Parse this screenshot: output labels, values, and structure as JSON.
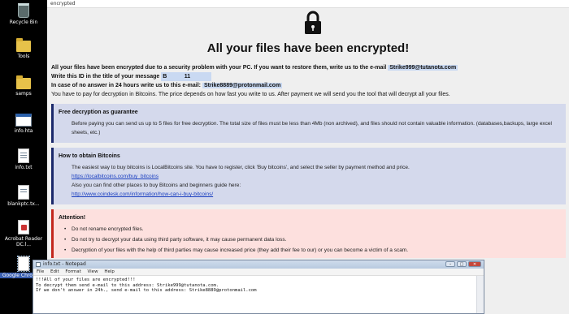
{
  "desktop": {
    "icons": [
      {
        "label": "Recycle Bin",
        "icon": "recycle-bin-icon"
      },
      {
        "label": "Tools",
        "icon": "folder-icon"
      },
      {
        "label": "samps",
        "icon": "folder-icon"
      },
      {
        "label": "info.hta",
        "icon": "hta-icon"
      },
      {
        "label": "info.txt",
        "icon": "text-file-icon"
      },
      {
        "label": "blankptc.tx...",
        "icon": "text-file-icon"
      },
      {
        "label": "Acrobat Reader DC.l...",
        "icon": "pdf-icon"
      },
      {
        "label": "Google Chrome...",
        "icon": "file-icon"
      }
    ]
  },
  "ransom_window": {
    "title": "encrypted",
    "lock_icon": "padlock-icon",
    "heading": "All your files have been encrypted!",
    "line1_text": "All your files have been encrypted due to a security problem with your PC. If you want to restore them, write us to the e-mail",
    "line1_email": "Strike999@tutanota.com",
    "line2_text": "Write this ID in the title of your message",
    "line2_id_start": "B",
    "line2_id_end": "11",
    "line3_text": "In case of no answer in 24 hours write us to this e-mail:",
    "line3_email": "Strike8889@protonmail.com",
    "line4_text": "You have to pay for decryption in Bitcoins. The price depends on how fast you write to us. After payment we will send you the tool that will decrypt all your files.",
    "free_decryption": {
      "title": "Free decryption as guarantee",
      "text": "Before paying you can send us up to 5 files for free decryption. The total size of files must be less than 4Mb (non archived), and files should not contain valuable information. (databases,backups, large excel sheets, etc.)"
    },
    "how_to_obtain": {
      "title": "How to obtain Bitcoins",
      "text1": "The easiest way to buy bitcoins is LocalBitcoins site. You have to register, click 'Buy bitcoins', and select the seller by payment method and price.",
      "link1": "https://localbitcoins.com/buy_bitcoins",
      "text2": "Also you can find other places to buy Bitcoins and beginners guide here:",
      "link2": "http://www.coindesk.com/information/how-can-i-buy-bitcoins/"
    },
    "attention": {
      "title": "Attention!",
      "items": [
        "Do not rename encrypted files.",
        "Do not try to decrypt your data using third party software, it may cause permanent data loss.",
        "Decryption of your files with the help of third parties may cause increased price (they add their fee to our) or you can become a victim of a scam."
      ]
    }
  },
  "notepad": {
    "title": "info.txt - Notepad",
    "menu": [
      "File",
      "Edit",
      "Format",
      "View",
      "Help"
    ],
    "minimize": "–",
    "maximize": "□",
    "close": "✕",
    "lines": [
      "!!!All of your files are encrypted!!!",
      "To decrypt them send e-mail to this address: Strike999@tutanota.com.",
      "If we don't answer in 24h., send e-mail to this address: Strike8889@protonmail.com"
    ]
  },
  "colors": {
    "panel_blue": "#d4d9ec",
    "panel_blue_bar": "#1c2a6b",
    "panel_red": "#fde0de",
    "panel_red_bar": "#c3271d",
    "highlight": "#c9d9f2"
  }
}
